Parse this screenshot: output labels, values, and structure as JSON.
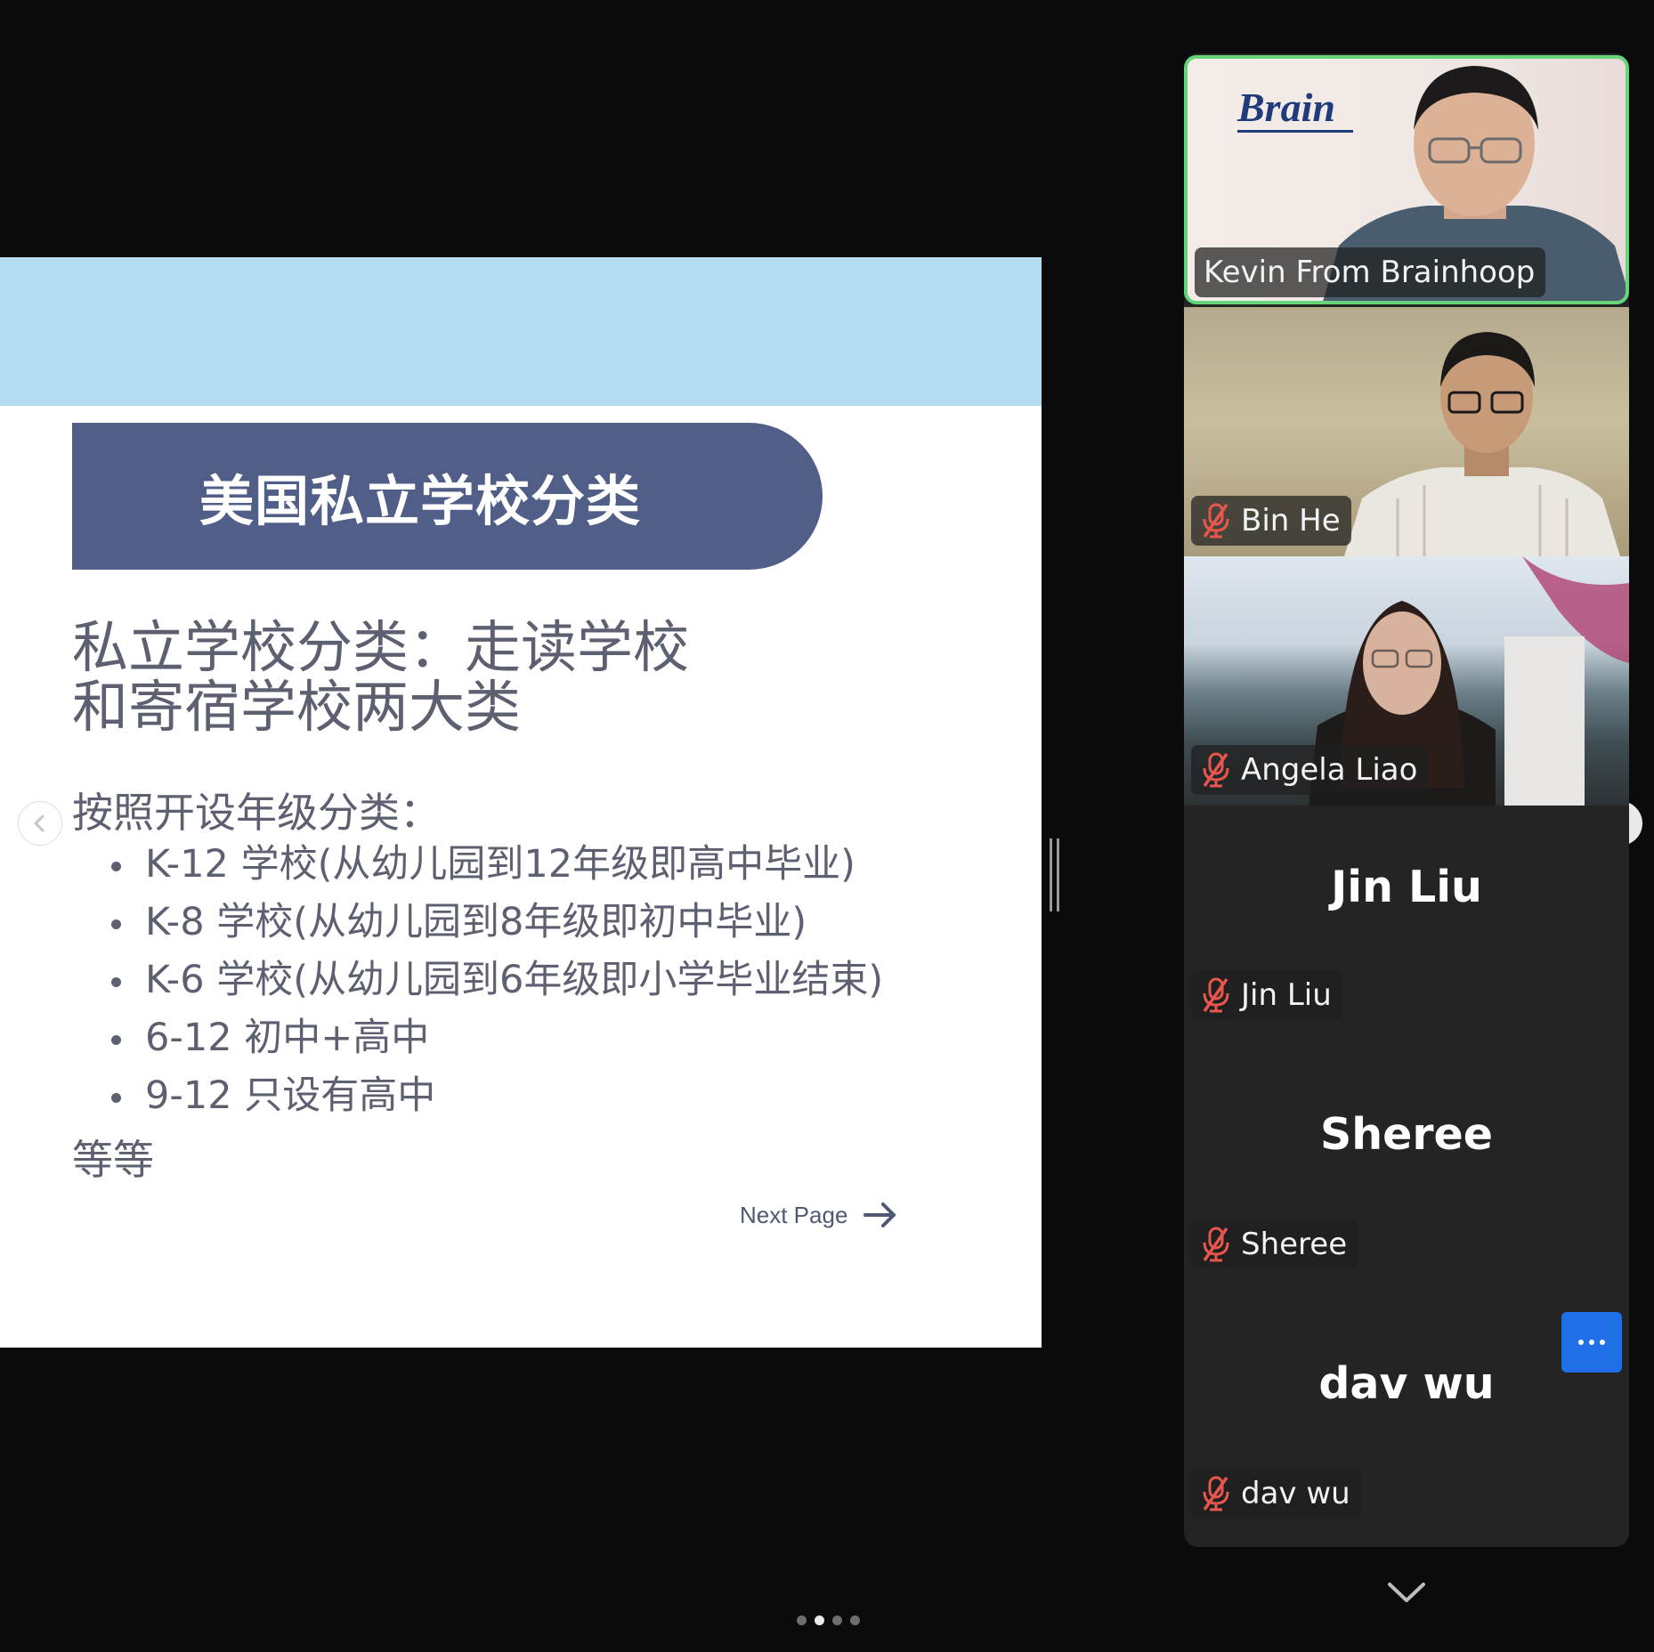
{
  "slide": {
    "title": "美国私立学校分类",
    "subtitle_lines": [
      "私立学校分类：走读学校",
      "和寄宿学校两大类"
    ],
    "list_heading": "按照开设年级分类：",
    "list_items": [
      "K-12 学校(从幼儿园到12年级即高中毕业)",
      "K-8 学校(从幼儿园到8年级即初中毕业)",
      "K-6 学校(从幼儿园到6年级即小学毕业结束)",
      "6-12 初中+高中",
      "9-12 只设有高中"
    ],
    "footer_text": "等等",
    "next_page_label": "Next Page"
  },
  "participants": {
    "video_tiles": [
      {
        "name": "Kevin From Brainhoop",
        "muted": false,
        "active_speaker": true,
        "logo_text": "Brain"
      },
      {
        "name": "Bin He",
        "muted": true,
        "active_speaker": false
      },
      {
        "name": "Angela Liao",
        "muted": true,
        "active_speaker": false
      }
    ],
    "audio_tiles": [
      {
        "display_name": "Jin Liu",
        "name": "Jin Liu",
        "muted": true
      },
      {
        "display_name": "Sheree",
        "name": "Sheree",
        "muted": true
      },
      {
        "display_name": "dav wu",
        "name": "dav wu",
        "muted": true
      }
    ]
  },
  "carousel": {
    "page_count": 4,
    "active_index": 1
  },
  "icons": {
    "prev": "chevron-left-icon",
    "next": "chevron-right-icon",
    "scroll_down": "chevron-down-icon",
    "muted": "mic-muted-icon",
    "more": "more-icon",
    "next_page": "arrow-right-icon"
  },
  "colors": {
    "slide_band": "#b3dcef",
    "slide_title_bar": "#505e88",
    "active_speaker_border": "#66d57a",
    "muted_icon": "#e8564d",
    "more_button": "#1f70e6"
  }
}
